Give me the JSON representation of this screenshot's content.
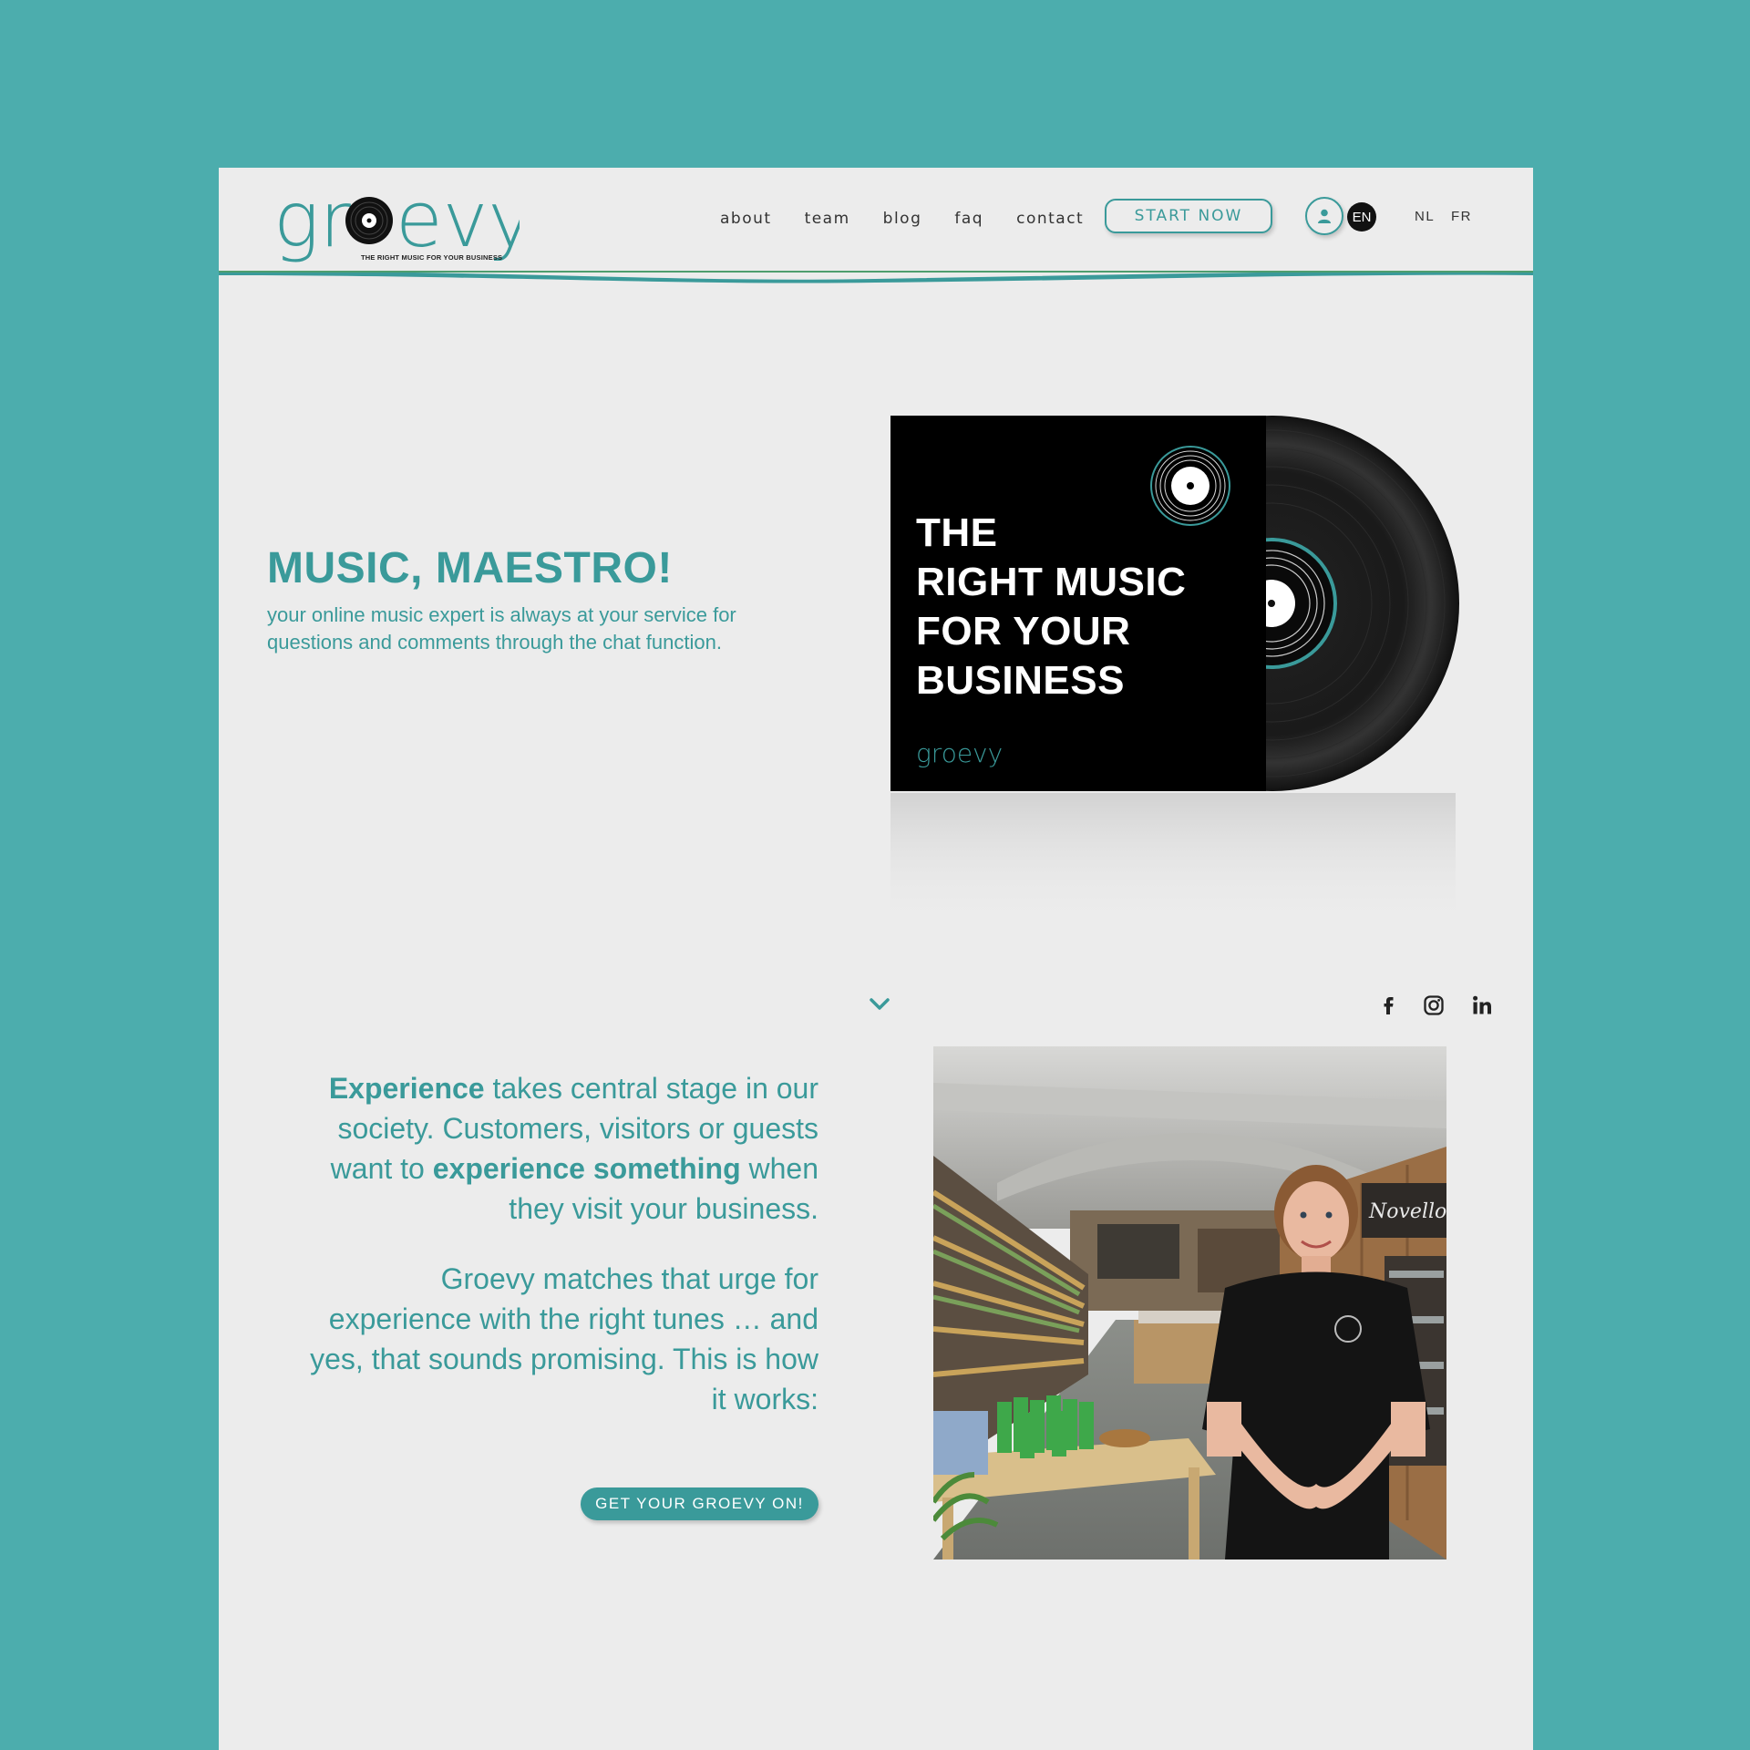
{
  "brand": {
    "logo_text": "groevy",
    "tagline": "THE RIGHT MUSIC FOR YOUR BUSINESS",
    "accent_color": "#3a9a9a",
    "background_color": "#4cadad",
    "page_color": "#ececec"
  },
  "nav": {
    "items": [
      {
        "label": "about"
      },
      {
        "label": "team"
      },
      {
        "label": "blog"
      },
      {
        "label": "faq"
      },
      {
        "label": "contact"
      }
    ],
    "start_label": "START NOW",
    "user_icon": "user-icon",
    "languages": {
      "active": "EN",
      "others": [
        "NL",
        "FR"
      ]
    }
  },
  "hero": {
    "title": "MUSIC, MAESTRO!",
    "subtitle": "your online music expert is always at your service for questions and comments through the chat function.",
    "album": {
      "lines": [
        "THE",
        "RIGHT MUSIC",
        "FOR YOUR",
        "BUSINESS"
      ],
      "logo_text": "groevy"
    }
  },
  "scroll_icon": "chevron-down-icon",
  "social": [
    "facebook-icon",
    "instagram-icon",
    "linkedin-icon"
  ],
  "experience": {
    "p1_bold1": "Experience",
    "p1_text1": " takes central stage in our society. Customers, visitors or guests want to ",
    "p1_bold2": "experience something",
    "p1_text2": " when they visit your business.",
    "p2": "Groevy matches that urge for experience with the right tunes … and yes, that sounds promising. This is how it works:",
    "cta_label": "GET YOUR GROEVY ON!"
  }
}
